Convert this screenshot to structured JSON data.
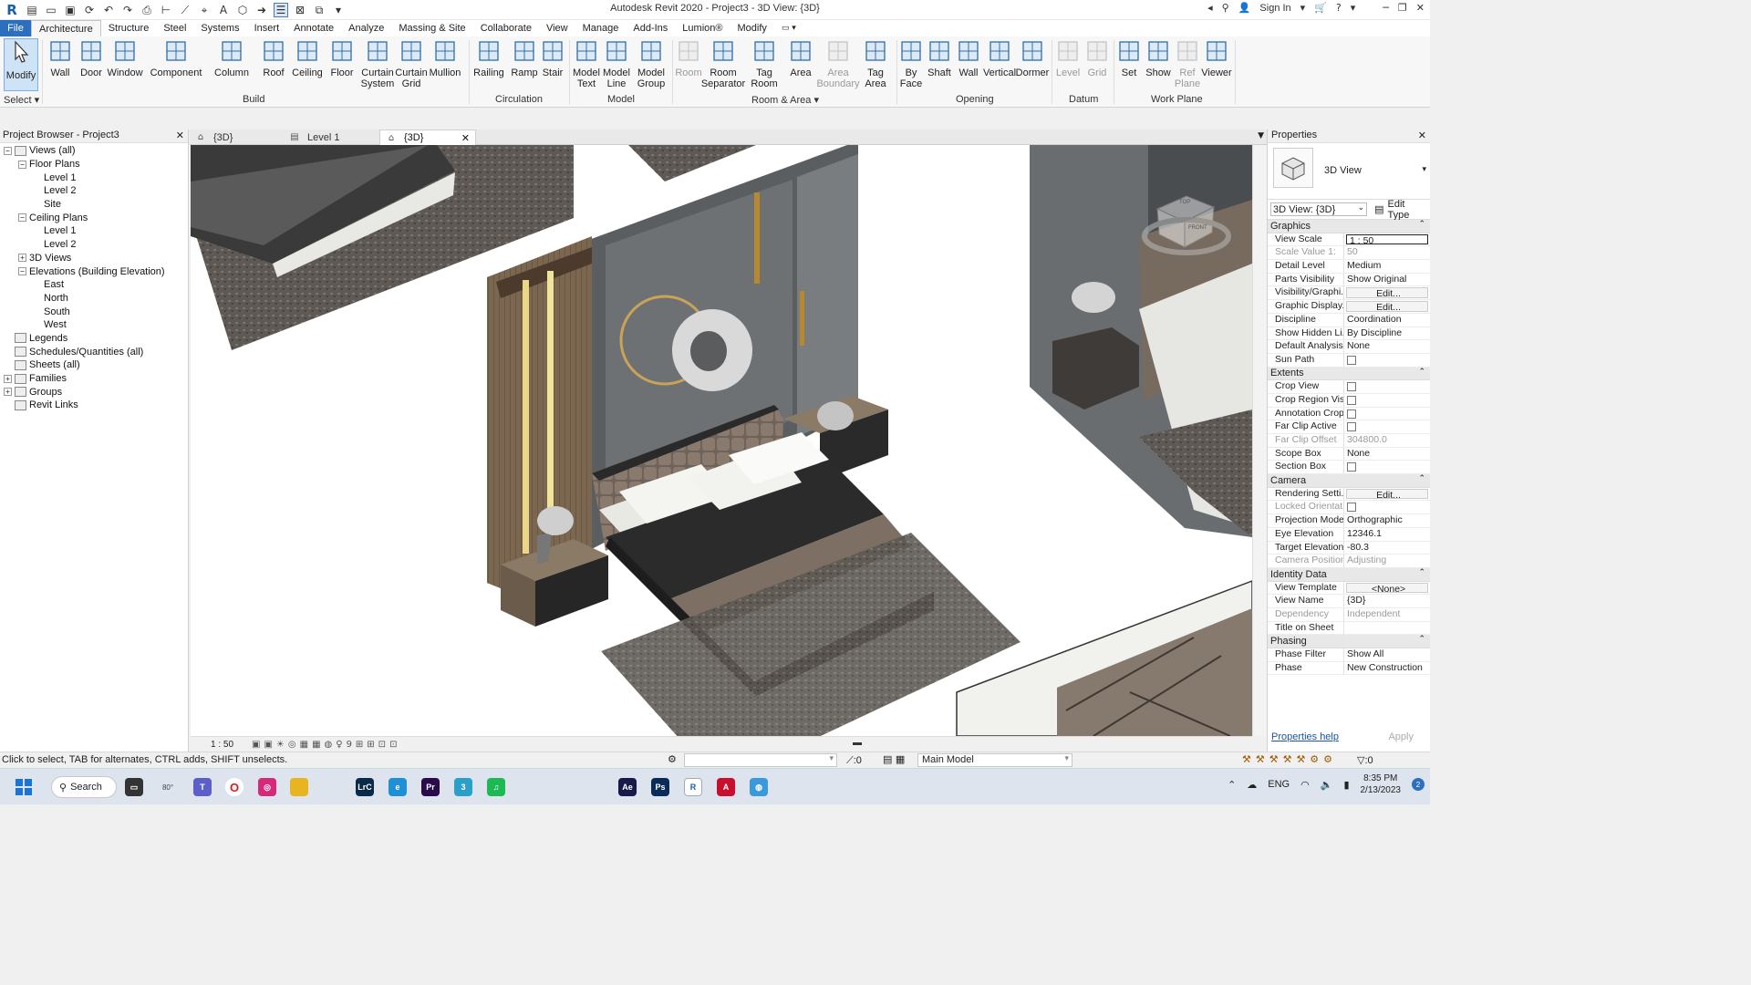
{
  "titlebar": {
    "app_title": "Autodesk Revit 2020 - Project3 - 3D View: {3D}",
    "sign_in": "Sign In",
    "help": "?",
    "text_tool": "A"
  },
  "menubar": {
    "file": "File",
    "tabs": [
      "Architecture",
      "Structure",
      "Steel",
      "Systems",
      "Insert",
      "Annotate",
      "Analyze",
      "Massing & Site",
      "Collaborate",
      "View",
      "Manage",
      "Add-Ins",
      "Lumion®",
      "Modify"
    ]
  },
  "ribbon": {
    "modify": "Modify",
    "select": "Select",
    "buttons": [
      {
        "label": "Wall",
        "icon": "wall-icon"
      },
      {
        "label": "Door",
        "icon": "door-icon"
      },
      {
        "label": "Window",
        "icon": "window-icon"
      },
      {
        "label": "Component",
        "icon": "component-icon"
      },
      {
        "label": "Column",
        "icon": "column-icon"
      },
      {
        "label": "Roof",
        "icon": "roof-icon"
      },
      {
        "label": "Ceiling",
        "icon": "ceiling-icon"
      },
      {
        "label": "Floor",
        "icon": "floor-icon"
      },
      {
        "label": "Curtain\nSystem",
        "icon": "curtain-system-icon"
      },
      {
        "label": "Curtain\nGrid",
        "icon": "curtain-grid-icon"
      },
      {
        "label": "Mullion",
        "icon": "mullion-icon"
      },
      {
        "label": "Railing",
        "icon": "railing-icon"
      },
      {
        "label": "Ramp",
        "icon": "ramp-icon"
      },
      {
        "label": "Stair",
        "icon": "stair-icon"
      },
      {
        "label": "Model\nText",
        "icon": "model-text-icon"
      },
      {
        "label": "Model\nLine",
        "icon": "model-line-icon"
      },
      {
        "label": "Model\nGroup",
        "icon": "model-group-icon"
      },
      {
        "label": "Room",
        "icon": "room-icon"
      },
      {
        "label": "Room\nSeparator",
        "icon": "room-separator-icon"
      },
      {
        "label": "Tag\nRoom",
        "icon": "tag-room-icon"
      },
      {
        "label": "Area",
        "icon": "area-icon"
      },
      {
        "label": "Area\nBoundary",
        "icon": "area-boundary-icon"
      },
      {
        "label": "Tag\nArea",
        "icon": "tag-area-icon"
      },
      {
        "label": "By\nFace",
        "icon": "by-face-icon"
      },
      {
        "label": "Shaft",
        "icon": "shaft-icon"
      },
      {
        "label": "Wall",
        "icon": "opening-wall-icon"
      },
      {
        "label": "Vertical",
        "icon": "vertical-icon"
      },
      {
        "label": "Dormer",
        "icon": "dormer-icon"
      },
      {
        "label": "Level",
        "icon": "level-icon"
      },
      {
        "label": "Grid",
        "icon": "grid-icon"
      },
      {
        "label": "Set",
        "icon": "set-icon"
      },
      {
        "label": "Show",
        "icon": "show-icon"
      },
      {
        "label": "Ref\nPlane",
        "icon": "ref-plane-icon"
      },
      {
        "label": "Viewer",
        "icon": "viewer-icon"
      }
    ],
    "panels": [
      "Build",
      "Circulation",
      "Model",
      "Room & Area",
      "Opening",
      "Datum",
      "Work Plane"
    ]
  },
  "project_browser": {
    "title": "Project Browser - Project3",
    "items": [
      {
        "label": "Views (all)",
        "level": 0,
        "toggle": "−"
      },
      {
        "label": "Floor Plans",
        "level": 1,
        "toggle": "−"
      },
      {
        "label": "Level 1",
        "level": 2
      },
      {
        "label": "Level 2",
        "level": 2
      },
      {
        "label": "Site",
        "level": 2
      },
      {
        "label": "Ceiling Plans",
        "level": 1,
        "toggle": "−"
      },
      {
        "label": "Level 1",
        "level": 2
      },
      {
        "label": "Level 2",
        "level": 2
      },
      {
        "label": "3D Views",
        "level": 1,
        "toggle": "+"
      },
      {
        "label": "Elevations (Building Elevation)",
        "level": 1,
        "toggle": "−"
      },
      {
        "label": "East",
        "level": 2
      },
      {
        "label": "North",
        "level": 2
      },
      {
        "label": "South",
        "level": 2
      },
      {
        "label": "West",
        "level": 2
      },
      {
        "label": "Legends",
        "level": 0
      },
      {
        "label": "Schedules/Quantities (all)",
        "level": 0
      },
      {
        "label": "Sheets (all)",
        "level": 0
      },
      {
        "label": "Families",
        "level": 0,
        "toggle": "+"
      },
      {
        "label": "Groups",
        "level": 0,
        "toggle": "+"
      },
      {
        "label": "Revit Links",
        "level": 0
      }
    ]
  },
  "view_tabs": [
    {
      "label": "{3D}",
      "active": false
    },
    {
      "label": "Level 1",
      "active": false
    },
    {
      "label": "{3D}",
      "active": true
    }
  ],
  "view": {
    "scale": "1 : 50",
    "viewcube_top": "TOP",
    "viewcube_front": "FRONT"
  },
  "properties": {
    "title": "Properties",
    "type_name": "3D View",
    "instance": "3D View: {3D}",
    "edit_type": "Edit Type",
    "groups": [
      {
        "name": "Graphics",
        "rows": [
          {
            "k": "View Scale",
            "v": "1 : 50",
            "style": "boxed"
          },
          {
            "k": "Scale Value    1:",
            "v": "50",
            "ro": true
          },
          {
            "k": "Detail Level",
            "v": "Medium"
          },
          {
            "k": "Parts Visibility",
            "v": "Show Original"
          },
          {
            "k": "Visibility/Graphi...",
            "v": "Edit...",
            "style": "btn"
          },
          {
            "k": "Graphic Display...",
            "v": "Edit...",
            "style": "btn"
          },
          {
            "k": "Discipline",
            "v": "Coordination"
          },
          {
            "k": "Show Hidden Li...",
            "v": "By Discipline"
          },
          {
            "k": "Default Analysis...",
            "v": "None"
          },
          {
            "k": "Sun Path",
            "v": "",
            "style": "cb"
          }
        ]
      },
      {
        "name": "Extents",
        "rows": [
          {
            "k": "Crop View",
            "v": "",
            "style": "cb"
          },
          {
            "k": "Crop Region Vis...",
            "v": "",
            "style": "cb"
          },
          {
            "k": "Annotation Crop",
            "v": "",
            "style": "cb"
          },
          {
            "k": "Far Clip Active",
            "v": "",
            "style": "cb"
          },
          {
            "k": "Far Clip Offset",
            "v": "304800.0",
            "ro": true
          },
          {
            "k": "Scope Box",
            "v": "None"
          },
          {
            "k": "Section Box",
            "v": "",
            "style": "cb"
          }
        ]
      },
      {
        "name": "Camera",
        "rows": [
          {
            "k": "Rendering Setti...",
            "v": "Edit...",
            "style": "btn"
          },
          {
            "k": "Locked Orientat...",
            "v": "",
            "style": "cb",
            "ro": true
          },
          {
            "k": "Projection Mode",
            "v": "Orthographic"
          },
          {
            "k": "Eye Elevation",
            "v": "12346.1"
          },
          {
            "k": "Target Elevation",
            "v": "-80.3"
          },
          {
            "k": "Camera Position",
            "v": "Adjusting",
            "ro": true
          }
        ]
      },
      {
        "name": "Identity Data",
        "rows": [
          {
            "k": "View Template",
            "v": "<None>",
            "style": "btn"
          },
          {
            "k": "View Name",
            "v": "{3D}"
          },
          {
            "k": "Dependency",
            "v": "Independent",
            "ro": true
          },
          {
            "k": "Title on Sheet",
            "v": ""
          }
        ]
      },
      {
        "name": "Phasing",
        "rows": [
          {
            "k": "Phase Filter",
            "v": "Show All"
          },
          {
            "k": "Phase",
            "v": "New Construction"
          }
        ]
      }
    ],
    "help_link": "Properties help",
    "apply": "Apply"
  },
  "statusbar": {
    "message": "Click to select, TAB for alternates, CTRL adds, SHIFT unselects.",
    "counter": ":0",
    "model": "Main Model",
    "filter_count": ":0"
  },
  "taskbar": {
    "search": "Search",
    "weather": "80°",
    "lang": "ENG",
    "time": "8:35 PM",
    "date": "2/13/2023",
    "notif": "2",
    "apps": [
      {
        "name": "file-explorer-icon",
        "color": "#e8b521",
        "txt": ""
      },
      {
        "name": "lightroom-classic-icon",
        "color": "#0a2a4a",
        "txt": "LrC"
      },
      {
        "name": "edge-icon",
        "color": "#1f8fd6",
        "txt": "e"
      },
      {
        "name": "premiere-icon",
        "color": "#2a0a4a",
        "txt": "Pr"
      },
      {
        "name": "app-3-icon",
        "color": "#2aa0c8",
        "txt": "3"
      },
      {
        "name": "spotify-icon",
        "color": "#1db954",
        "txt": "♫"
      },
      {
        "name": "after-effects-icon",
        "color": "#1a1a4a",
        "txt": "Ae"
      },
      {
        "name": "photoshop-icon",
        "color": "#0a2a5a",
        "txt": "Ps"
      },
      {
        "name": "revit-icon",
        "color": "#ffffff",
        "txt": "R"
      },
      {
        "name": "autocad-icon",
        "color": "#c8102e",
        "txt": "A"
      }
    ]
  }
}
